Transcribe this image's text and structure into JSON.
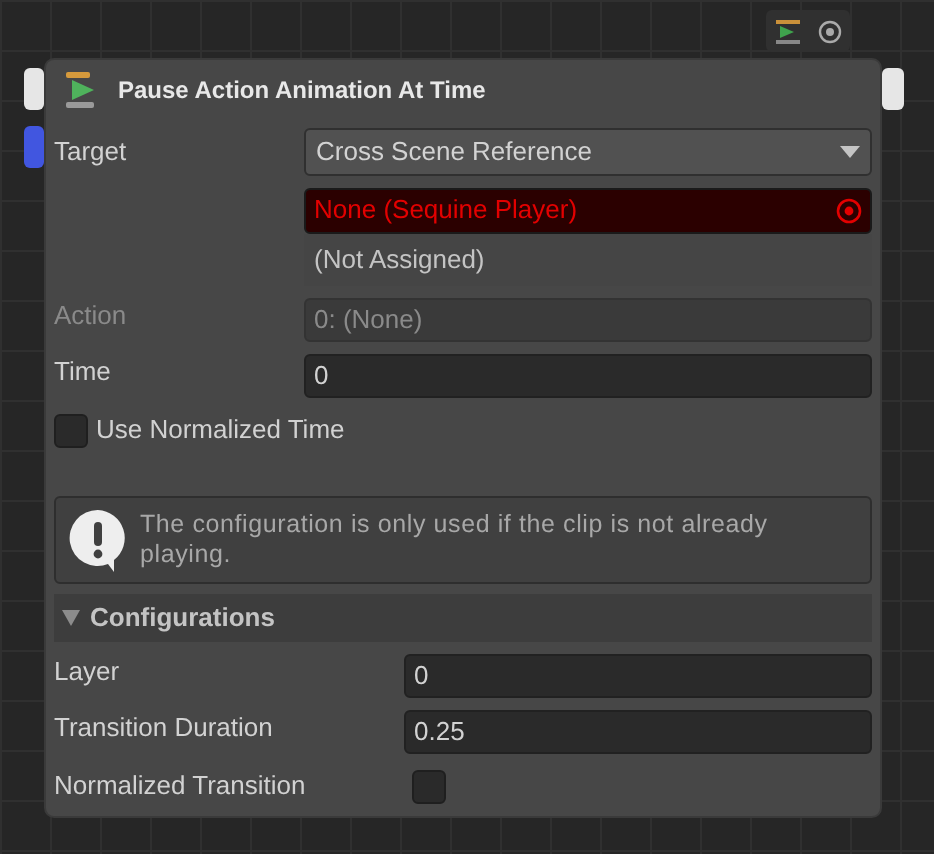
{
  "node": {
    "title": "Pause Action Animation At Time",
    "fields": [
      {
        "kind": "dropdown",
        "label": "Target",
        "value": "Cross Scene Reference"
      },
      {
        "kind": "reference",
        "value": "None (Sequine Player)"
      },
      {
        "kind": "note",
        "value": "(Not Assigned)"
      },
      {
        "kind": "text",
        "label": "Action",
        "value": "0: (None)",
        "disabled": true
      },
      {
        "kind": "text",
        "label": "Time",
        "value": "0",
        "disabled": false
      },
      {
        "kind": "checkbox",
        "label": "Use Normalized Time",
        "checked": false
      }
    ],
    "help": {
      "text": "The configuration is only used if the clip is not already playing."
    },
    "section": {
      "title": "Configurations",
      "expanded": true,
      "fields": [
        {
          "kind": "text",
          "label": "Layer",
          "value": "0"
        },
        {
          "kind": "text",
          "label": "Transition Duration",
          "value": "0.25"
        },
        {
          "kind": "checkbox",
          "label": "Normalized Transition",
          "checked": false
        }
      ]
    }
  }
}
